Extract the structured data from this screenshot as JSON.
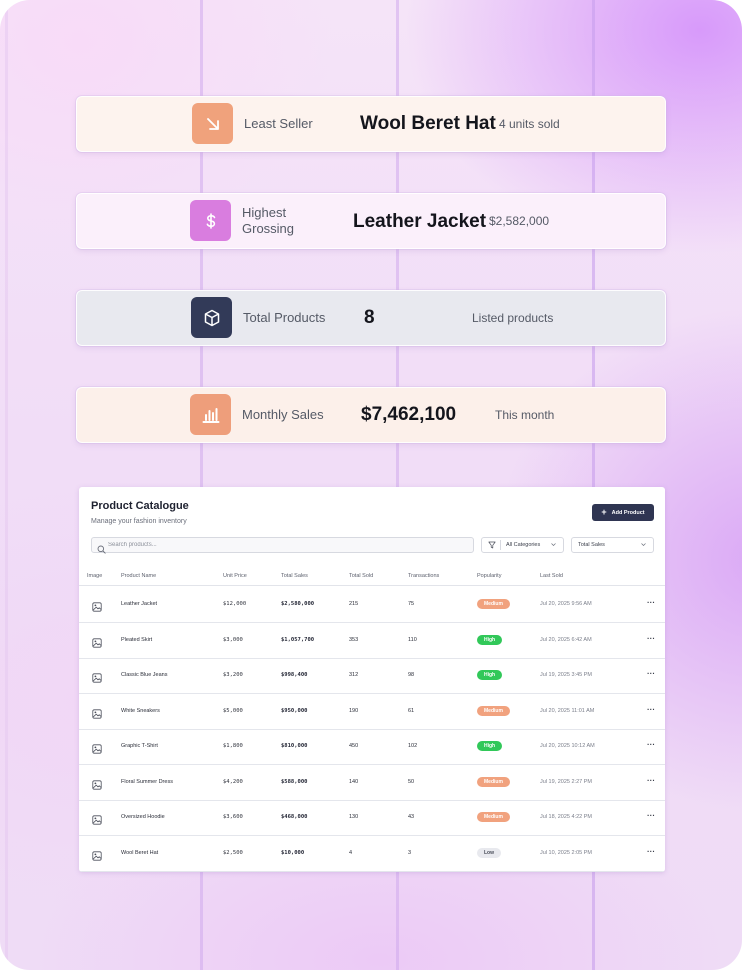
{
  "stats": {
    "least_seller": {
      "label": "Least Seller",
      "value": "Wool Beret Hat",
      "sub": "4 units sold",
      "icon": "arrow-down-right-icon",
      "accent": "#f0a27c"
    },
    "highest_grossing": {
      "label_line1": "Highest",
      "label_line2": "Grossing",
      "value": "Leather Jacket",
      "sub": "$2,582,000",
      "icon": "dollar-icon",
      "accent": "#d97ddf"
    },
    "total_products": {
      "label": "Total Products",
      "value": "8",
      "sub": "Listed products",
      "icon": "box-icon",
      "accent": "#323a58"
    },
    "monthly_sales": {
      "label": "Monthly Sales",
      "value": "$7,462,100",
      "sub": "This month",
      "icon": "bar-chart-icon",
      "accent": "#ee9e7b"
    }
  },
  "catalogue": {
    "title": "Product Catalogue",
    "subtitle": "Manage your fashion inventory",
    "add_button": "Add Product",
    "search_placeholder": "Search products...",
    "category_filter": "All Categories",
    "sort_select": "Total Sales",
    "columns": [
      "Image",
      "Product Name",
      "Unit Price",
      "Total Sales",
      "Total Sold",
      "Transactions",
      "Popularity",
      "Last Sold"
    ],
    "rows": [
      {
        "name": "Leather Jacket",
        "unit_price": "$12,000",
        "total_sales": "$2,580,000",
        "total_sold": "215",
        "transactions": "75",
        "popularity": "Medium",
        "last_sold": "Jul 20, 2025 9:56 AM"
      },
      {
        "name": "Pleated Skirt",
        "unit_price": "$3,000",
        "total_sales": "$1,057,700",
        "total_sold": "353",
        "transactions": "110",
        "popularity": "High",
        "last_sold": "Jul 20, 2025 6:42 AM"
      },
      {
        "name": "Classic Blue Jeans",
        "unit_price": "$3,200",
        "total_sales": "$998,400",
        "total_sold": "312",
        "transactions": "98",
        "popularity": "High",
        "last_sold": "Jul 19, 2025 3:45 PM"
      },
      {
        "name": "White Sneakers",
        "unit_price": "$5,000",
        "total_sales": "$950,000",
        "total_sold": "190",
        "transactions": "61",
        "popularity": "Medium",
        "last_sold": "Jul 20, 2025 11:01 AM"
      },
      {
        "name": "Graphic T-Shirt",
        "unit_price": "$1,800",
        "total_sales": "$810,000",
        "total_sold": "450",
        "transactions": "102",
        "popularity": "High",
        "last_sold": "Jul 20, 2025 10:12 AM"
      },
      {
        "name": "Floral Summer Dress",
        "unit_price": "$4,200",
        "total_sales": "$588,000",
        "total_sold": "140",
        "transactions": "50",
        "popularity": "Medium",
        "last_sold": "Jul 19, 2025 2:27 PM"
      },
      {
        "name": "Oversized Hoodie",
        "unit_price": "$3,600",
        "total_sales": "$468,000",
        "total_sold": "130",
        "transactions": "43",
        "popularity": "Medium",
        "last_sold": "Jul 18, 2025 4:22 PM"
      },
      {
        "name": "Wool Beret Hat",
        "unit_price": "$2,500",
        "total_sales": "$10,000",
        "total_sold": "4",
        "transactions": "3",
        "popularity": "Low",
        "last_sold": "Jul 10, 2025 2:05 PM"
      }
    ]
  }
}
